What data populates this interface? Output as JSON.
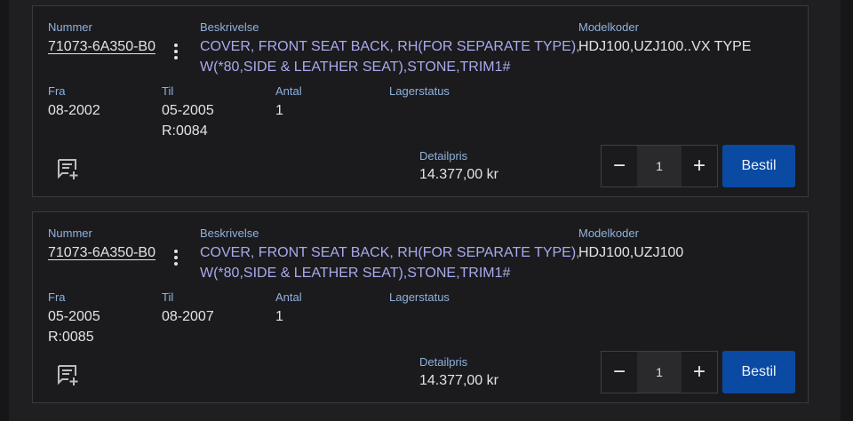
{
  "labels": {
    "number": "Nummer",
    "description": "Beskrivelse",
    "model_codes": "Modelkoder",
    "from": "Fra",
    "to": "Til",
    "quantity": "Antal",
    "stock_status": "Lagerstatus",
    "retail_price": "Detailpris",
    "order_button": "Bestil",
    "minus": "−",
    "plus": "+"
  },
  "items": [
    {
      "part_number": "71073-6A350-B0",
      "description_line1": "COVER, FRONT SEAT BACK, RH(FOR SEPARATE TYPE),",
      "description_line2": "W(*80,SIDE & LEATHER SEAT),STONE,TRIM1#",
      "model_codes": "HDJ100,UZJ100..VX TYPE",
      "from": "08-2002",
      "from_ref": "",
      "to": "05-2005",
      "to_ref": "R:0084",
      "quantity": "1",
      "stock_status": "",
      "price": "14.377,00 kr",
      "order_qty": "1"
    },
    {
      "part_number": "71073-6A350-B0",
      "description_line1": "COVER, FRONT SEAT BACK, RH(FOR SEPARATE TYPE),",
      "description_line2": "W(*80,SIDE & LEATHER SEAT),STONE,TRIM1#",
      "model_codes": "HDJ100,UZJ100",
      "from": "05-2005",
      "from_ref": "R:0085",
      "to": "08-2007",
      "to_ref": "",
      "quantity": "1",
      "stock_status": "",
      "price": "14.377,00 kr",
      "order_qty": "1"
    }
  ]
}
